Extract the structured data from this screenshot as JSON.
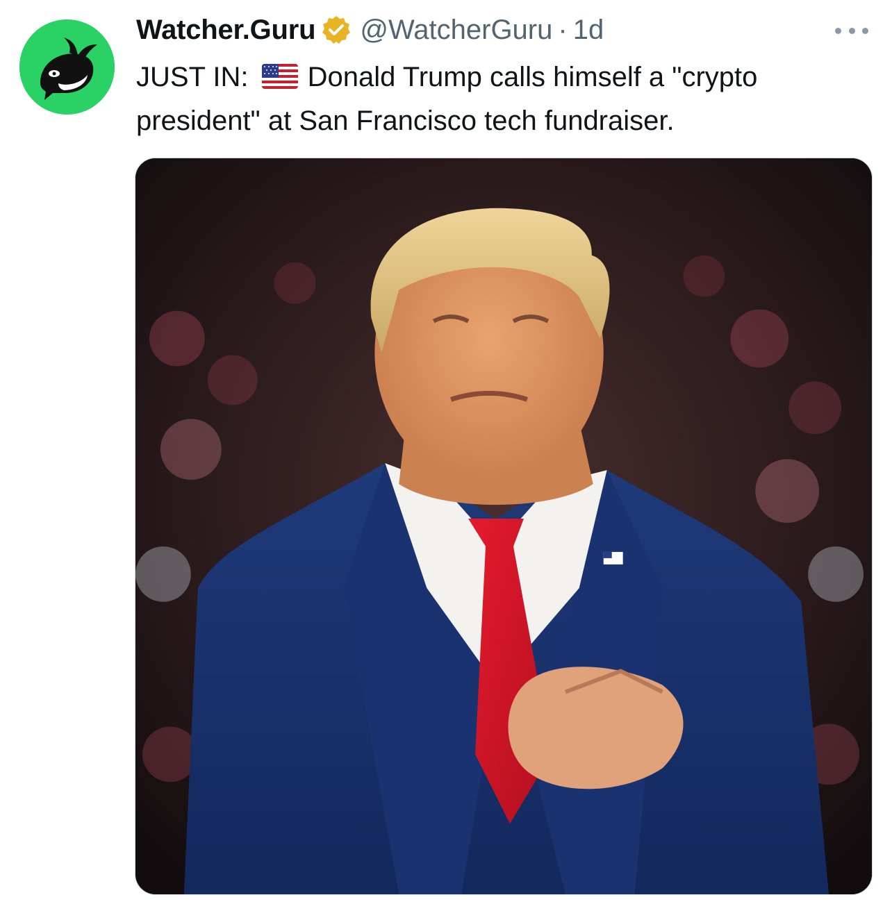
{
  "author": {
    "display_name": "Watcher.Guru",
    "handle": "@WatcherGuru",
    "separator": "·",
    "timestamp": "1d",
    "verified": true,
    "avatar_icon": "whale-logo-icon",
    "avatar_color": "#2ad266",
    "badge_color": "#e8b425"
  },
  "tweet": {
    "prefix": "JUST IN:",
    "flag": "us-flag-icon",
    "body": "Donald Trump calls himself a \"crypto president\" at San Francisco tech fundraiser."
  },
  "media": {
    "alt": "Donald Trump in navy suit and red tie clasping hands in front of a crowd"
  },
  "actions": {
    "more_icon": "more-options-icon"
  }
}
